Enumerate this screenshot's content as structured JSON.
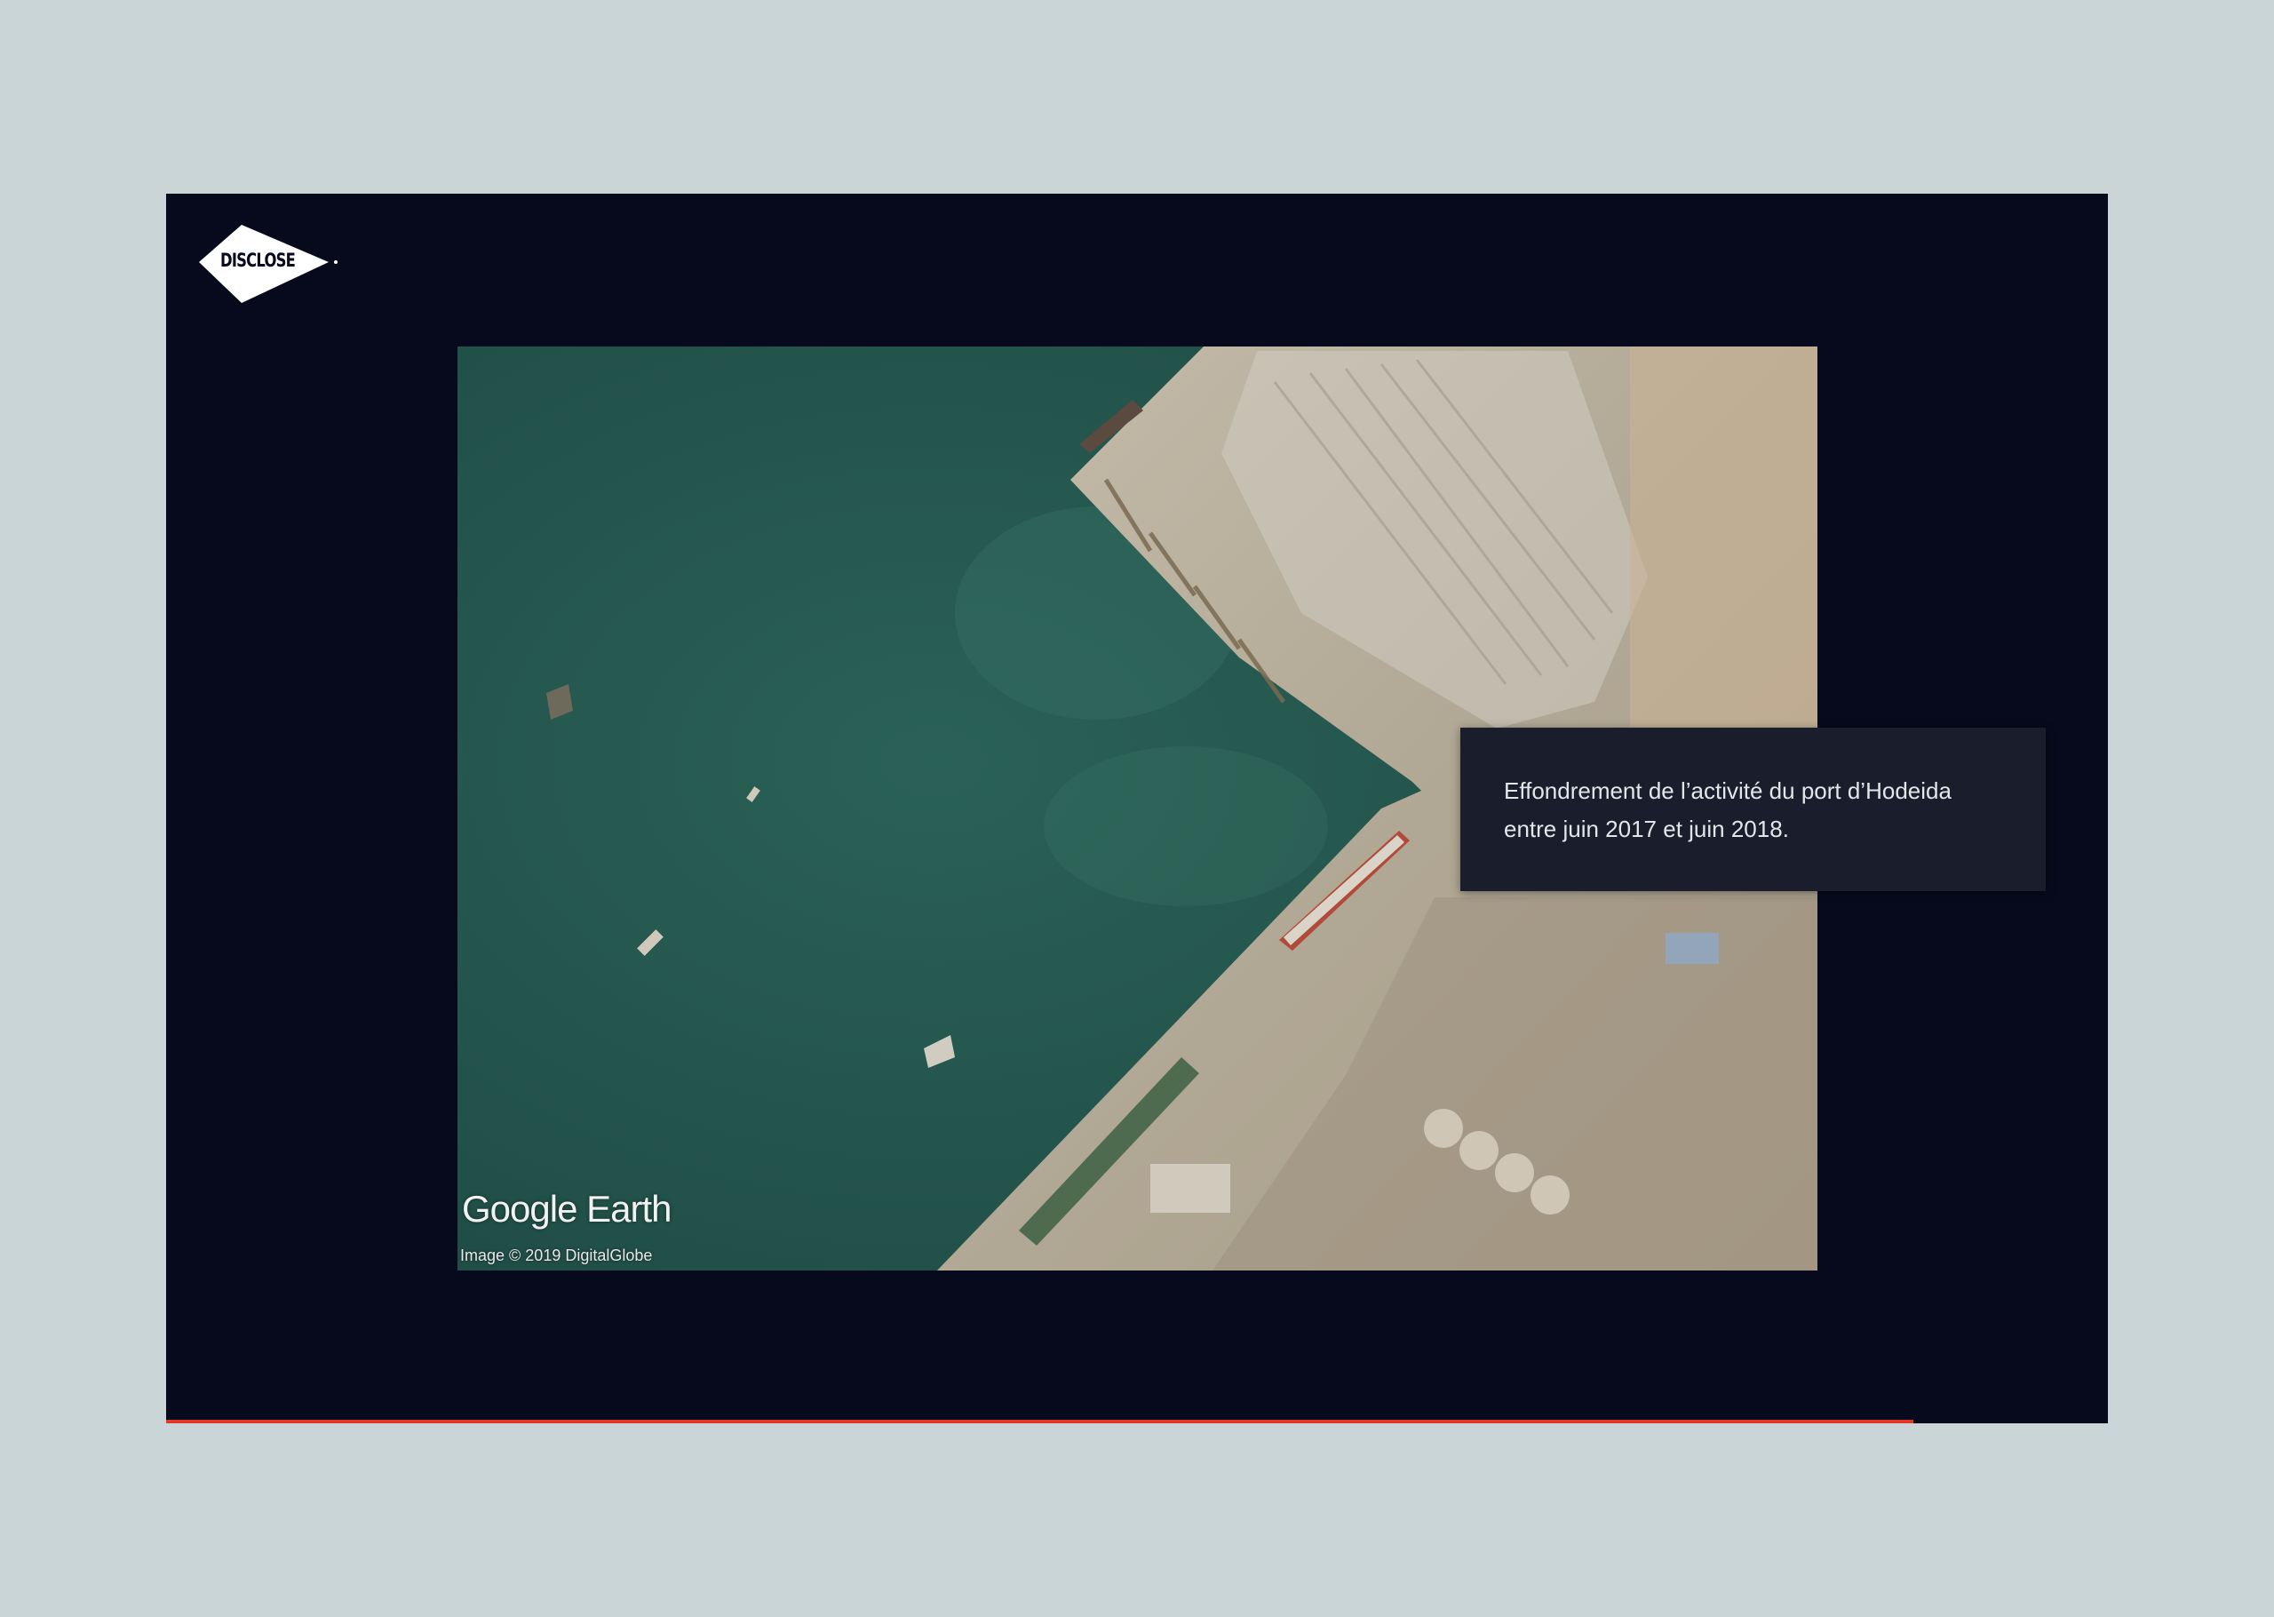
{
  "brand": {
    "logo_text": "DISCLOSE"
  },
  "map": {
    "source_brand": "Google Earth",
    "credit": "Image © 2019 DigitalGlobe"
  },
  "caption": {
    "line1": "Effondrement de l’activité du port d’Hodeida",
    "line2": "entre juin 2017 et juin 2018."
  },
  "progress": {
    "fraction": 0.9
  },
  "colors": {
    "page_background": "#c9d5d7",
    "frame_background": "#060a1c",
    "caption_background": "#1a1e2c",
    "progress_accent": "#e2362a",
    "sea": "#24564d",
    "land": "#b9ad98"
  }
}
